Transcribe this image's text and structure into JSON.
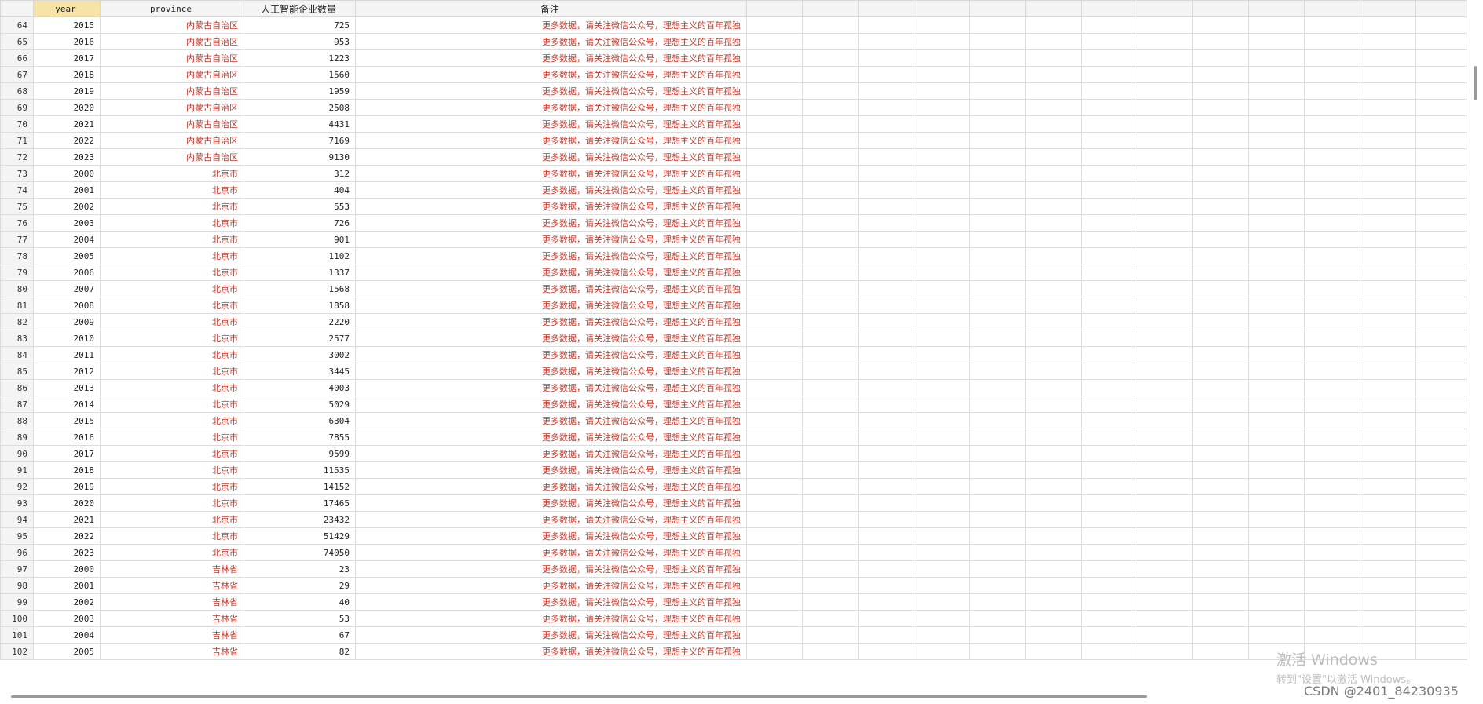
{
  "columns": {
    "year": "year",
    "province": "province",
    "count": "人工智能企业数量",
    "note": "备注"
  },
  "rows": [
    {
      "n": "64",
      "year": "2015",
      "province": "内蒙古自治区",
      "count": "725",
      "note": "更多数据，请关注微信公众号，理想主义的百年孤独"
    },
    {
      "n": "65",
      "year": "2016",
      "province": "内蒙古自治区",
      "count": "953",
      "note": "更多数据，请关注微信公众号，理想主义的百年孤独"
    },
    {
      "n": "66",
      "year": "2017",
      "province": "内蒙古自治区",
      "count": "1223",
      "note": "更多数据，请关注微信公众号，理想主义的百年孤独"
    },
    {
      "n": "67",
      "year": "2018",
      "province": "内蒙古自治区",
      "count": "1560",
      "note": "更多数据，请关注微信公众号，理想主义的百年孤独"
    },
    {
      "n": "68",
      "year": "2019",
      "province": "内蒙古自治区",
      "count": "1959",
      "note": "更多数据，请关注微信公众号，理想主义的百年孤独"
    },
    {
      "n": "69",
      "year": "2020",
      "province": "内蒙古自治区",
      "count": "2508",
      "note": "更多数据，请关注微信公众号，理想主义的百年孤独"
    },
    {
      "n": "70",
      "year": "2021",
      "province": "内蒙古自治区",
      "count": "4431",
      "note": "更多数据，请关注微信公众号，理想主义的百年孤独"
    },
    {
      "n": "71",
      "year": "2022",
      "province": "内蒙古自治区",
      "count": "7169",
      "note": "更多数据，请关注微信公众号，理想主义的百年孤独"
    },
    {
      "n": "72",
      "year": "2023",
      "province": "内蒙古自治区",
      "count": "9130",
      "note": "更多数据，请关注微信公众号，理想主义的百年孤独"
    },
    {
      "n": "73",
      "year": "2000",
      "province": "北京市",
      "count": "312",
      "note": "更多数据，请关注微信公众号，理想主义的百年孤独"
    },
    {
      "n": "74",
      "year": "2001",
      "province": "北京市",
      "count": "404",
      "note": "更多数据，请关注微信公众号，理想主义的百年孤独"
    },
    {
      "n": "75",
      "year": "2002",
      "province": "北京市",
      "count": "553",
      "note": "更多数据，请关注微信公众号，理想主义的百年孤独"
    },
    {
      "n": "76",
      "year": "2003",
      "province": "北京市",
      "count": "726",
      "note": "更多数据，请关注微信公众号，理想主义的百年孤独"
    },
    {
      "n": "77",
      "year": "2004",
      "province": "北京市",
      "count": "901",
      "note": "更多数据，请关注微信公众号，理想主义的百年孤独"
    },
    {
      "n": "78",
      "year": "2005",
      "province": "北京市",
      "count": "1102",
      "note": "更多数据，请关注微信公众号，理想主义的百年孤独"
    },
    {
      "n": "79",
      "year": "2006",
      "province": "北京市",
      "count": "1337",
      "note": "更多数据，请关注微信公众号，理想主义的百年孤独"
    },
    {
      "n": "80",
      "year": "2007",
      "province": "北京市",
      "count": "1568",
      "note": "更多数据，请关注微信公众号，理想主义的百年孤独"
    },
    {
      "n": "81",
      "year": "2008",
      "province": "北京市",
      "count": "1858",
      "note": "更多数据，请关注微信公众号，理想主义的百年孤独"
    },
    {
      "n": "82",
      "year": "2009",
      "province": "北京市",
      "count": "2220",
      "note": "更多数据，请关注微信公众号，理想主义的百年孤独"
    },
    {
      "n": "83",
      "year": "2010",
      "province": "北京市",
      "count": "2577",
      "note": "更多数据，请关注微信公众号，理想主义的百年孤独"
    },
    {
      "n": "84",
      "year": "2011",
      "province": "北京市",
      "count": "3002",
      "note": "更多数据，请关注微信公众号，理想主义的百年孤独"
    },
    {
      "n": "85",
      "year": "2012",
      "province": "北京市",
      "count": "3445",
      "note": "更多数据，请关注微信公众号，理想主义的百年孤独"
    },
    {
      "n": "86",
      "year": "2013",
      "province": "北京市",
      "count": "4003",
      "note": "更多数据，请关注微信公众号，理想主义的百年孤独"
    },
    {
      "n": "87",
      "year": "2014",
      "province": "北京市",
      "count": "5029",
      "note": "更多数据，请关注微信公众号，理想主义的百年孤独"
    },
    {
      "n": "88",
      "year": "2015",
      "province": "北京市",
      "count": "6304",
      "note": "更多数据，请关注微信公众号，理想主义的百年孤独"
    },
    {
      "n": "89",
      "year": "2016",
      "province": "北京市",
      "count": "7855",
      "note": "更多数据，请关注微信公众号，理想主义的百年孤独"
    },
    {
      "n": "90",
      "year": "2017",
      "province": "北京市",
      "count": "9599",
      "note": "更多数据，请关注微信公众号，理想主义的百年孤独"
    },
    {
      "n": "91",
      "year": "2018",
      "province": "北京市",
      "count": "11535",
      "note": "更多数据，请关注微信公众号，理想主义的百年孤独"
    },
    {
      "n": "92",
      "year": "2019",
      "province": "北京市",
      "count": "14152",
      "note": "更多数据，请关注微信公众号，理想主义的百年孤独"
    },
    {
      "n": "93",
      "year": "2020",
      "province": "北京市",
      "count": "17465",
      "note": "更多数据，请关注微信公众号，理想主义的百年孤独"
    },
    {
      "n": "94",
      "year": "2021",
      "province": "北京市",
      "count": "23432",
      "note": "更多数据，请关注微信公众号，理想主义的百年孤独"
    },
    {
      "n": "95",
      "year": "2022",
      "province": "北京市",
      "count": "51429",
      "note": "更多数据，请关注微信公众号，理想主义的百年孤独"
    },
    {
      "n": "96",
      "year": "2023",
      "province": "北京市",
      "count": "74050",
      "note": "更多数据，请关注微信公众号，理想主义的百年孤独"
    },
    {
      "n": "97",
      "year": "2000",
      "province": "吉林省",
      "count": "23",
      "note": "更多数据，请关注微信公众号，理想主义的百年孤独"
    },
    {
      "n": "98",
      "year": "2001",
      "province": "吉林省",
      "count": "29",
      "note": "更多数据，请关注微信公众号，理想主义的百年孤独"
    },
    {
      "n": "99",
      "year": "2002",
      "province": "吉林省",
      "count": "40",
      "note": "更多数据，请关注微信公众号，理想主义的百年孤独"
    },
    {
      "n": "100",
      "year": "2003",
      "province": "吉林省",
      "count": "53",
      "note": "更多数据，请关注微信公众号，理想主义的百年孤独"
    },
    {
      "n": "101",
      "year": "2004",
      "province": "吉林省",
      "count": "67",
      "note": "更多数据，请关注微信公众号，理想主义的百年孤独"
    },
    {
      "n": "102",
      "year": "2005",
      "province": "吉林省",
      "count": "82",
      "note": "更多数据，请关注微信公众号，理想主义的百年孤独"
    }
  ],
  "watermark": {
    "line1": "激活 Windows",
    "line2": "转到\"设置\"以激活 Windows。",
    "credit": "CSDN @2401_84230935"
  }
}
